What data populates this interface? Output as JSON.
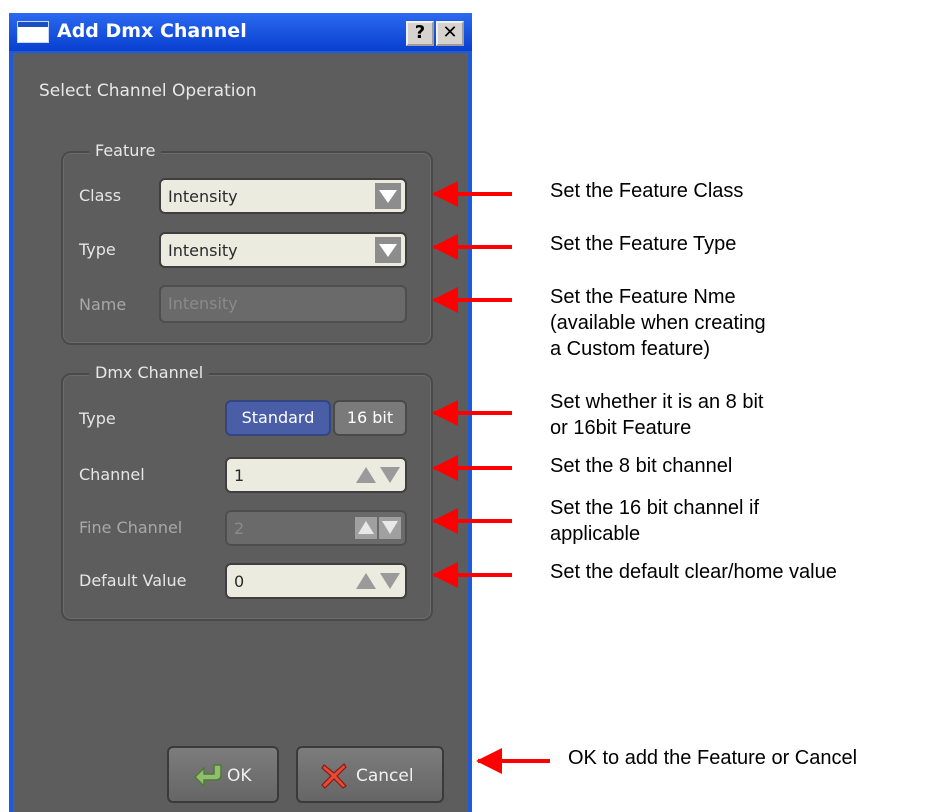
{
  "window": {
    "title": "Add Dmx Channel",
    "help_label": "?",
    "close_label": "✕"
  },
  "dialog": {
    "subtitle": "Select Channel Operation",
    "feature_group": {
      "label": "Feature",
      "class_label": "Class",
      "class_value": "Intensity",
      "type_label": "Type",
      "type_value": "Intensity",
      "name_label": "Name",
      "name_placeholder": "Intensity"
    },
    "dmx_group": {
      "label": "Dmx Channel",
      "type_label": "Type",
      "type_options": [
        "Standard",
        "16 bit"
      ],
      "type_selected": "Standard",
      "channel_label": "Channel",
      "channel_value": "1",
      "fine_channel_label": "Fine Channel",
      "fine_channel_value": "2",
      "default_value_label": "Default Value",
      "default_value_value": "0"
    },
    "ok_label": "OK",
    "cancel_label": "Cancel"
  },
  "annotations": {
    "class": "Set the Feature Class",
    "type": "Set the Feature Type",
    "name": [
      "Set the Feature Nme",
      "(available when creating",
      "a Custom feature)"
    ],
    "bit_type": [
      "Set whether it is an 8 bit",
      "or 16bit Feature"
    ],
    "channel": "Set the 8 bit channel",
    "fine_channel": [
      "Set the 16 bit channel if",
      "applicable"
    ],
    "default_value": "Set the default clear/home value",
    "buttons": "OK to add the Feature or Cancel"
  },
  "colors": {
    "titlebar": "#0a3fd0",
    "dialog_bg": "#5d5d5d",
    "selected_segment": "#4a5ea8",
    "annotation_arrow": "#ff0000"
  }
}
